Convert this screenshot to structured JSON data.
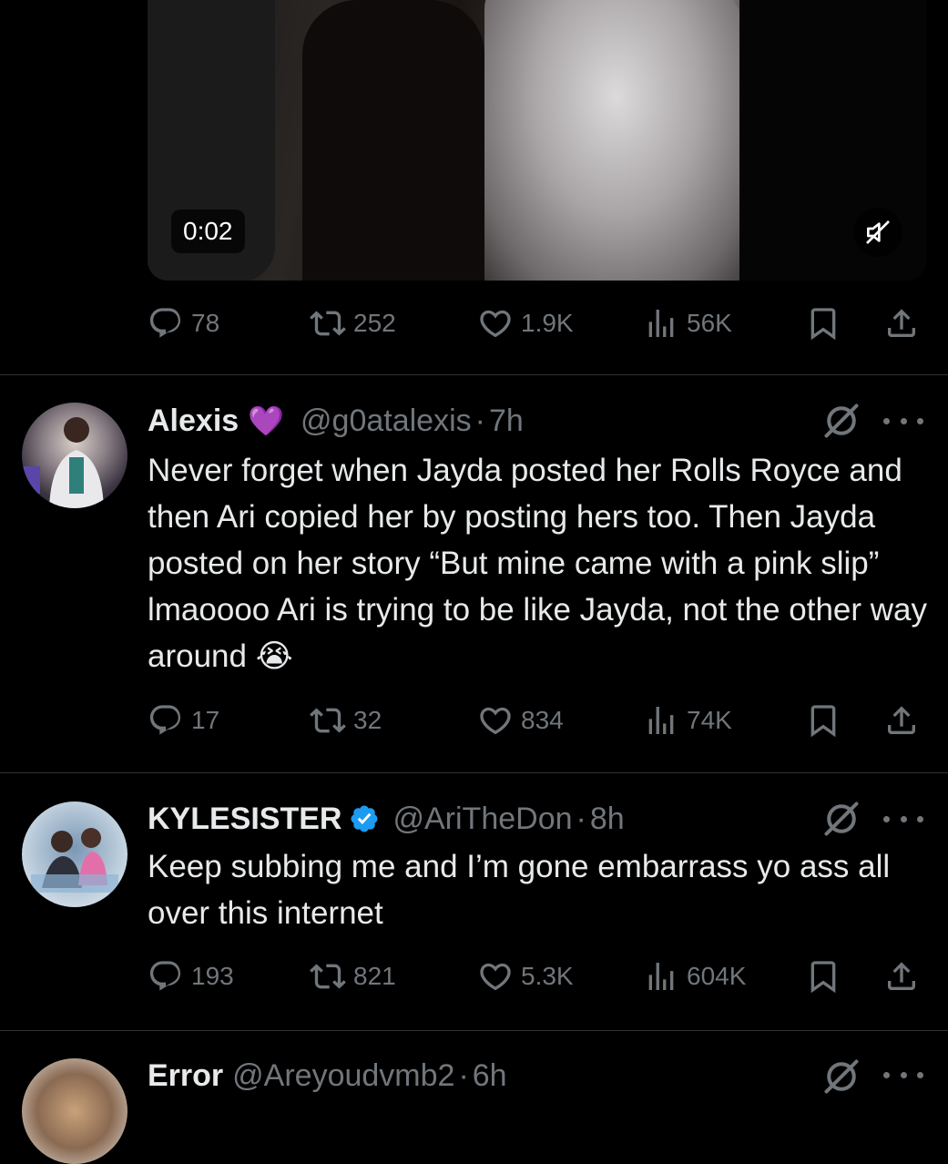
{
  "video": {
    "time": "0:02",
    "mute_icon": "speaker-muted-icon",
    "stats": {
      "replies": "78",
      "reposts": "252",
      "likes": "1.9K",
      "views": "56K"
    }
  },
  "tweets": [
    {
      "name": "Alexis",
      "name_emoji": "💜",
      "handle": "@g0atalexis",
      "time": "7h",
      "text": "Never forget when Jayda posted her Rolls Royce and then Ari copied her by posting hers too. Then Jayda posted on her story “But mine came with a pink slip” lmaoooo Ari is trying to be like Jayda, not the other way around 😭",
      "stats": {
        "replies": "17",
        "reposts": "32",
        "likes": "834",
        "views": "74K"
      }
    },
    {
      "name": "KYLESISTER",
      "verified": true,
      "handle": "@AriTheDon",
      "time": "8h",
      "text": "Keep subbing me and I’m gone embarrass yo ass all over this internet",
      "stats": {
        "replies": "193",
        "reposts": "821",
        "likes": "5.3K",
        "views": "604K"
      }
    },
    {
      "name": "Error",
      "handle": "@Areyoudvmb2",
      "time": "6h"
    }
  ],
  "separator": "·",
  "colors": {
    "background": "#000000",
    "text": "#e7e9ea",
    "muted": "#71767b",
    "verified": "#1d9bf0",
    "divider": "#2f3336"
  }
}
